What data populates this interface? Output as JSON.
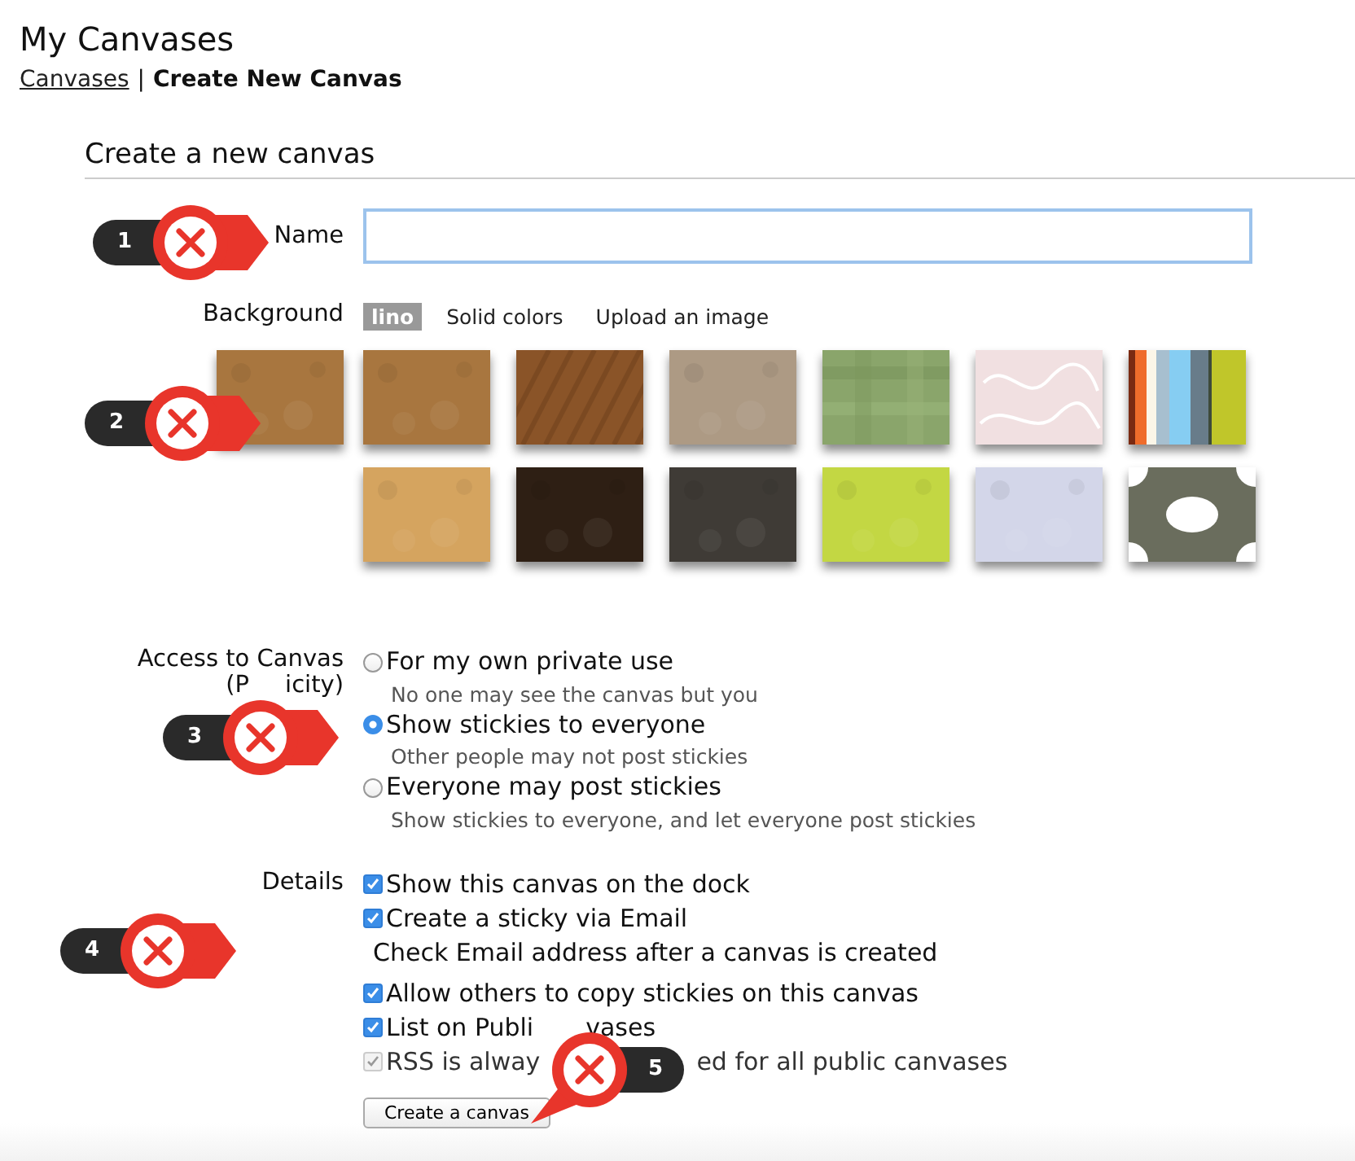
{
  "page": {
    "title": "My Canvases"
  },
  "breadcrumb": {
    "link": "Canvases",
    "separator": "|",
    "current": "Create New Canvas"
  },
  "form": {
    "heading": "Create a new canvas",
    "name": {
      "label": "Name",
      "focused": true
    },
    "background": {
      "label": "Background",
      "tabs": [
        {
          "label": "lino",
          "selected": true
        },
        {
          "label": "Solid colors",
          "selected": false
        },
        {
          "label": "Upload an image",
          "selected": false
        }
      ],
      "preview": {
        "kind": "texture",
        "color": "#a8763f"
      },
      "swatches": [
        {
          "kind": "texture",
          "color": "#a8763f"
        },
        {
          "kind": "diagonal",
          "color": "#8a5428"
        },
        {
          "kind": "texture",
          "color": "#ad9a84"
        },
        {
          "kind": "weave",
          "color": "#8aa56b"
        },
        {
          "kind": "swirl",
          "color": "#f1e0e1"
        },
        {
          "kind": "stripes",
          "color": "#c0c62a"
        },
        {
          "kind": "texture",
          "color": "#d5a45f"
        },
        {
          "kind": "texture",
          "color": "#2e1f14"
        },
        {
          "kind": "texture",
          "color": "#3f3b36"
        },
        {
          "kind": "texture",
          "color": "#c3d743"
        },
        {
          "kind": "texture",
          "color": "#d3d6e9"
        },
        {
          "kind": "dots",
          "color": "#6a6d5d"
        }
      ]
    },
    "access": {
      "label": "Access to Canvas",
      "sublabel": [
        "(P",
        "icity)"
      ],
      "options": [
        {
          "label": "For my own private use",
          "hint": "No one may see the canvas but you",
          "selected": false
        },
        {
          "label": "Show stickies to everyone",
          "hint": "Other people may not post stickies",
          "selected": true
        },
        {
          "label": "Everyone may post stickies",
          "hint": "Show stickies to everyone, and let everyone post stickies",
          "selected": false
        }
      ]
    },
    "details": {
      "label": "Details",
      "items": [
        {
          "kind": "checkbox",
          "label": "Show this canvas on the dock",
          "checked": true,
          "disabled": false
        },
        {
          "kind": "checkbox",
          "label": "Create a sticky via Email",
          "checked": true,
          "disabled": false
        },
        {
          "kind": "note",
          "label": "Check Email address after a canvas is created"
        },
        {
          "kind": "checkbox",
          "label": "Allow others to copy stickies on this canvas",
          "checked": true,
          "disabled": false
        },
        {
          "kind": "checkbox",
          "label": "List on Publi",
          "label_after": "vases",
          "checked": true,
          "disabled": false
        },
        {
          "kind": "checkbox",
          "label": "RSS is alway",
          "label_after": "ed for all public canvases",
          "checked": true,
          "disabled": true
        }
      ]
    },
    "submit": "Create a canvas"
  },
  "callouts": [
    {
      "number": "1",
      "kind": "point-right"
    },
    {
      "number": "2",
      "kind": "point-right"
    },
    {
      "number": "3",
      "kind": "point-right"
    },
    {
      "number": "4",
      "kind": "point-right"
    },
    {
      "number": "5",
      "kind": "point-down"
    }
  ]
}
